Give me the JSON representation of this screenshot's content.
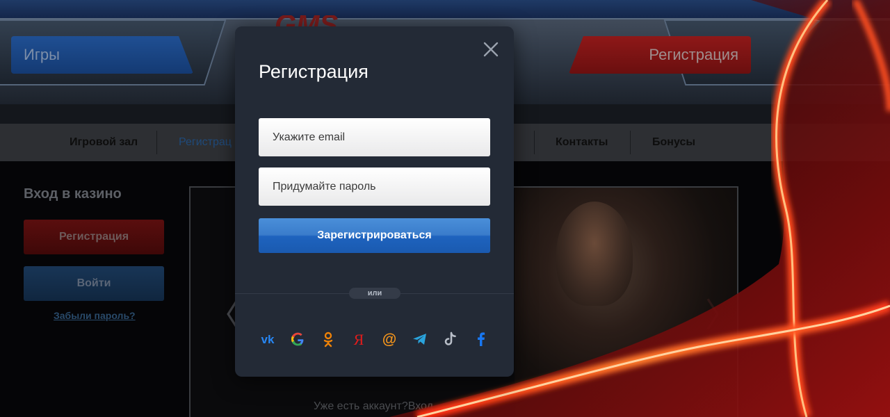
{
  "header": {
    "games_label": "Игры",
    "register_label": "Регистрация",
    "logo_text": "GMS"
  },
  "nav": {
    "items": [
      "Игровой зал",
      "Регистрац",
      "Контакты",
      "Бонусы"
    ]
  },
  "sidebar": {
    "title": "Вход в казино",
    "register_label": "Регистрация",
    "login_label": "Войти",
    "forgot_label": "Забыли пароль?"
  },
  "slider": {
    "prev_symbol": "〈",
    "next_symbol": "〉"
  },
  "footer": {
    "have_account": "Уже есть аккаунт?Вход"
  },
  "modal": {
    "title": "Регистрация",
    "email_placeholder": "Укажите email",
    "password_placeholder": "Придумайте пароль",
    "submit_label": "Зарегистрироваться",
    "or_label": "или",
    "social_icons": [
      "vk-icon",
      "google-icon",
      "odnoklassniki-icon",
      "yandex-icon",
      "mail-icon",
      "telegram-icon",
      "tiktok-icon",
      "facebook-icon"
    ]
  },
  "colors": {
    "modal_bg": "#232a36",
    "submit_blue": "#1e63be",
    "vk": "#2787f5",
    "odnoklassniki": "#ee8208",
    "yandex": "#e31c1c",
    "mail": "#f2941c",
    "telegram": "#2aa3dc",
    "facebook": "#1877f2"
  }
}
